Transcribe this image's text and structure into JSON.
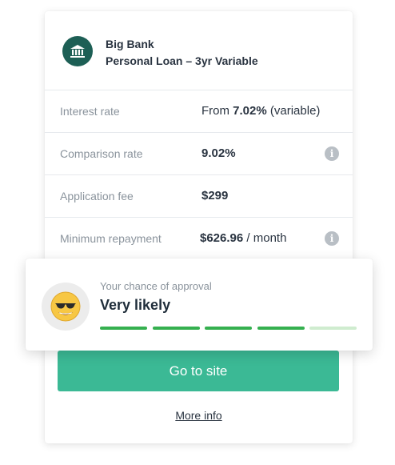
{
  "bank": {
    "name": "Big Bank",
    "product": "Personal Loan – 3yr Variable",
    "logo_icon": "bank-building-icon",
    "logo_color": "#1d5f55"
  },
  "details": [
    {
      "label": "Interest rate",
      "value_prefix": "From ",
      "value_bold": "7.02%",
      "value_suffix": " (variable)",
      "has_info": false
    },
    {
      "label": "Comparison rate",
      "value_prefix": "",
      "value_bold": "9.02%",
      "value_suffix": "",
      "has_info": true
    },
    {
      "label": "Application fee",
      "value_prefix": "",
      "value_bold": "$299",
      "value_suffix": "",
      "has_info": false
    },
    {
      "label": "Minimum repayment",
      "value_prefix": "",
      "value_bold": "$626.96",
      "value_suffix": " / month",
      "has_info": true
    }
  ],
  "info_glyph": "i",
  "approval": {
    "label": "Your chance of approval",
    "value": "Very likely",
    "emoji_icon": "sunglasses-face-icon",
    "level_filled": 4,
    "level_total": 5,
    "filled_color": "#35b04f",
    "empty_color": "#cfeccf"
  },
  "actions": {
    "go_label": "Go to site",
    "more_label": "More info",
    "accent": "#3bb995"
  }
}
